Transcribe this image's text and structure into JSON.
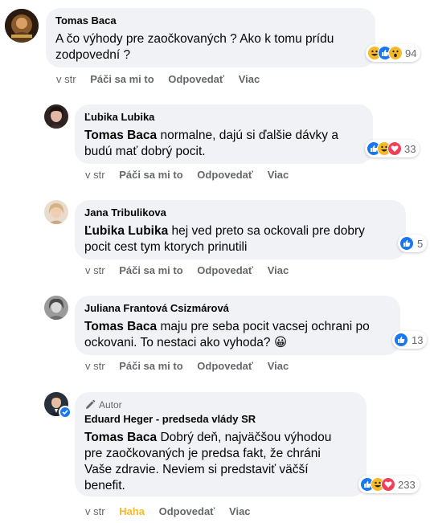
{
  "comments": [
    {
      "author": "Tomas Baca",
      "text_line1": "A čo výhody pre zaočkovaných ? Ako k tomu prídu",
      "text_line2": "zodpovední ?",
      "reaction_count": "94",
      "actions": {
        "time": "v str",
        "like": "Páči sa mi to",
        "reply": "Odpovedať",
        "more": "Viac"
      }
    },
    {
      "author": "Ľubika Lubika",
      "mention": "Tomas Baca",
      "text_rest_line1": "normalne, dajú si ďalšie dávky a",
      "text_line2": "budú mať dobrý pocit.",
      "reaction_count": "33",
      "actions": {
        "time": "v str",
        "like": "Páči sa mi to",
        "reply": "Odpovedať",
        "more": "Viac"
      }
    },
    {
      "author": "Jana Tribulikova",
      "mention": "Ľubika Lubika",
      "text_rest_line1": "hej ved preto sa ockovali pre dobry",
      "text_line2": "pocit cest tym ktorych prinutili",
      "reaction_count": "5",
      "actions": {
        "time": "v str",
        "like": "Páči sa mi to",
        "reply": "Odpovedať",
        "more": "Viac"
      }
    },
    {
      "author": "Juliana Frantová Csizmárová",
      "mention": "Tomas Baca",
      "text_rest_line1": "maju pre seba pocit vacsej ochrani po",
      "text_line2": "ockovani. To nestaci ako vyhoda?",
      "emoji": "😀",
      "reaction_count": "13",
      "actions": {
        "time": "v str",
        "like": "Páči sa mi to",
        "reply": "Odpovedať",
        "more": "Viac"
      }
    },
    {
      "badge": "Autor",
      "author": "Eduard Heger - predseda vlády SR",
      "mention": "Tomas Baca",
      "text_rest_line1": "Dobrý deň, najväčšou výhodou",
      "text_line2": "pre zaočkovaných je predsa fakt, že chráni",
      "text_line3": "Vaše zdravie. Neviem si predstaviť väčší",
      "text_line4": "benefit.",
      "reaction_count": "233",
      "actions": {
        "time": "v str",
        "like": "Haha",
        "reply": "Odpovedať",
        "more": "Viac"
      }
    }
  ],
  "colors": {
    "bubble": "#f0f2f5",
    "like_blue": "#1877f2",
    "haha_yellow": "#f7b928",
    "love_red": "#f33e58",
    "meta_gray": "#65676b"
  },
  "icons": [
    "like-icon",
    "haha-icon",
    "wow-icon",
    "love-icon",
    "pencil-icon",
    "verified-badge-icon"
  ]
}
